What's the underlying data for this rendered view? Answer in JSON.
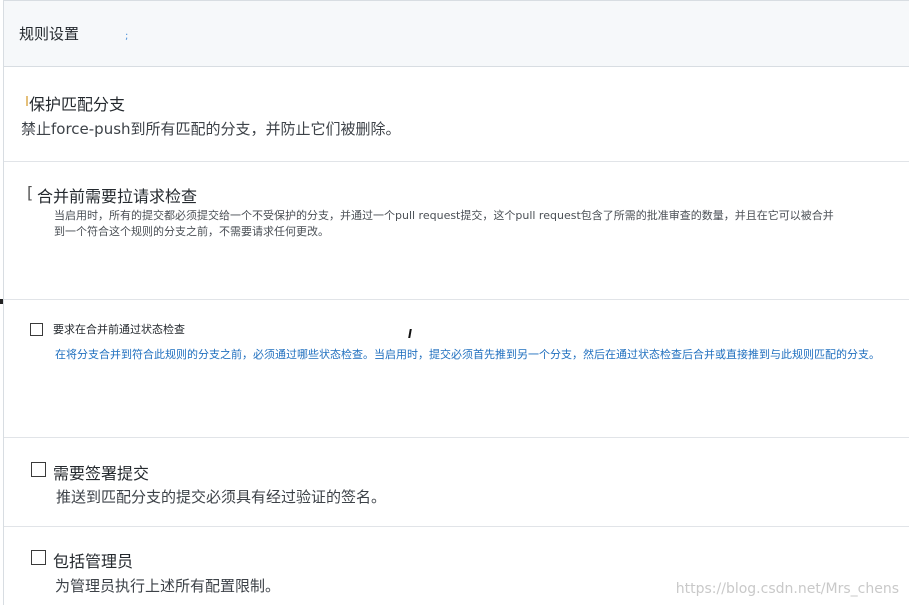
{
  "header": {
    "title": "规则设置",
    "stray_mark": ";"
  },
  "protect": {
    "title": "保护匹配分支",
    "description": "禁止force-push到所有匹配的分支，并防止它们被删除。"
  },
  "pr_review": {
    "bracket": "[",
    "title": "合并前需要拉请求检查",
    "description": "当启用时，所有的提交都必须提交给一个不受保护的分支，并通过一个pull request提交，这个pull request包含了所需的批准审查的数量，并且在它可以被合并到一个符合这个规则的分支之前，不需要请求任何更改。"
  },
  "status_checks": {
    "checked": false,
    "title": "要求在合并前通过状态检查",
    "description": "在将分支合并到符合此规则的分支之前，必须通过哪些状态检查。当启用时，提交必须首先推到另一个分支，然后在通过状态检查后合并或直接推到与此规则匹配的分支。"
  },
  "signed_commits": {
    "checked": false,
    "title": "需要签署提交",
    "description": "推送到匹配分支的提交必须具有经过验证的签名。"
  },
  "include_admins": {
    "checked": false,
    "title": "包括管理员",
    "description": "为管理员执行上述所有配置限制。"
  },
  "watermark": "https://blog.csdn.net/Mrs_chens",
  "colors": {
    "header_bg": "#f6f8fa",
    "border": "#e1e4e8",
    "link_blue": "#1f6fbf",
    "text": "#24292e"
  }
}
